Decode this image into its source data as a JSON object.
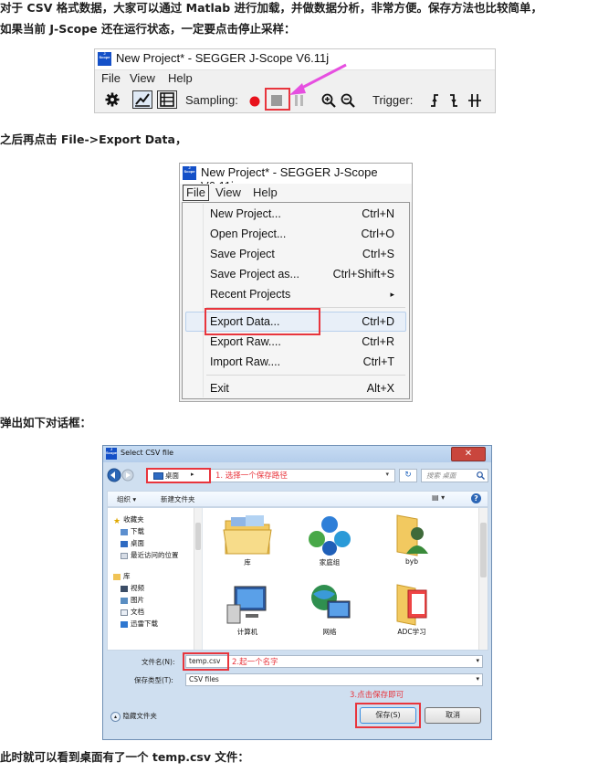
{
  "article": {
    "p1": "对于 CSV 格式数据，大家可以通过 Matlab 进行加载，并做数据分析，非常方便。保存方法也比较简单，",
    "p2": "如果当前 J-Scope 还在运行状态，一定要点击停止采样：",
    "p3": "之后再点击 File->Export Data，",
    "p4": "弹出如下对话框：",
    "p5": "此时就可以看到桌面有了一个 temp.csv 文件："
  },
  "jscope": {
    "logo": "J",
    "logo_sub": "Scope",
    "title": "New Project* - SEGGER J-Scope V6.11j",
    "menu": [
      "File",
      "View",
      "Help"
    ],
    "sampling_label": "Sampling:",
    "trigger_label": "Trigger:",
    "colors": {
      "record": "#e8121c",
      "stop": "#9a9a9a",
      "highlight": "#e8353d",
      "arrow": "#e64fe0"
    }
  },
  "file_menu": {
    "items": [
      {
        "label": "New Project...",
        "shortcut": "Ctrl+N"
      },
      {
        "label": "Open Project...",
        "shortcut": "Ctrl+O"
      },
      {
        "label": "Save Project",
        "shortcut": "Ctrl+S"
      },
      {
        "label": "Save Project as...",
        "shortcut": "Ctrl+Shift+S"
      },
      {
        "label": "Recent Projects",
        "shortcut": "▸"
      },
      {
        "label": "Export Data...",
        "shortcut": "Ctrl+D"
      },
      {
        "label": "Export Raw....",
        "shortcut": "Ctrl+R"
      },
      {
        "label": "Import Raw....",
        "shortcut": "Ctrl+T"
      },
      {
        "label": "Exit",
        "shortcut": "Alt+X"
      }
    ]
  },
  "save_dialog": {
    "title": "Select CSV file",
    "close": "✕",
    "breadcrumb": "桌面",
    "breadcrumb_arrow": "▸",
    "search_placeholder": "搜索 桌面",
    "organize": "组织 ▾",
    "new_folder": "新建文件夹",
    "nav": {
      "favorites": "收藏夹",
      "downloads": "下载",
      "desktop": "桌面",
      "recent": "最近访问的位置",
      "libraries": "库",
      "videos": "视频",
      "pictures": "图片",
      "documents": "文档",
      "thunder": "迅雷下载"
    },
    "files": [
      "库",
      "家庭组",
      "byb",
      "计算机",
      "网络",
      "ADC学习"
    ],
    "filename_label": "文件名(N):",
    "filename_value": "temp.csv",
    "filetype_label": "保存类型(T):",
    "filetype_value": "CSV  files",
    "hide_folders": "隐藏文件夹",
    "save_button": "保存(S)",
    "cancel_button": "取消"
  },
  "annotations": {
    "step1": "1. 选择一个保存路径",
    "step2": "2.起一个名字",
    "step3": "3.点击保存即可"
  }
}
